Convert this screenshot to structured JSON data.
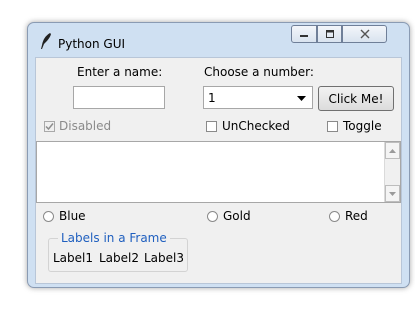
{
  "window": {
    "title": "Python GUI",
    "minimize_icon": "minimize-icon",
    "maximize_icon": "maximize-icon",
    "close_icon": "close-icon",
    "app_icon": "feather-icon"
  },
  "form": {
    "name_label": "Enter a name:",
    "name_value": "",
    "number_label": "Choose a number:",
    "number_value": "1",
    "click_button": "Click Me!"
  },
  "checks": [
    {
      "label": "Disabled",
      "checked": true,
      "disabled": true
    },
    {
      "label": "UnChecked",
      "checked": false,
      "disabled": false
    },
    {
      "label": "Toggle",
      "checked": false,
      "disabled": false
    }
  ],
  "radios": [
    {
      "label": "Blue"
    },
    {
      "label": "Gold"
    },
    {
      "label": "Red"
    }
  ],
  "label_frame": {
    "title": "Labels in a Frame",
    "labels": [
      "Label1",
      "Label2",
      "Label3"
    ]
  },
  "colors": {
    "frame_title": "#1f5fbf",
    "window_chrome": "#cfe0f2"
  }
}
